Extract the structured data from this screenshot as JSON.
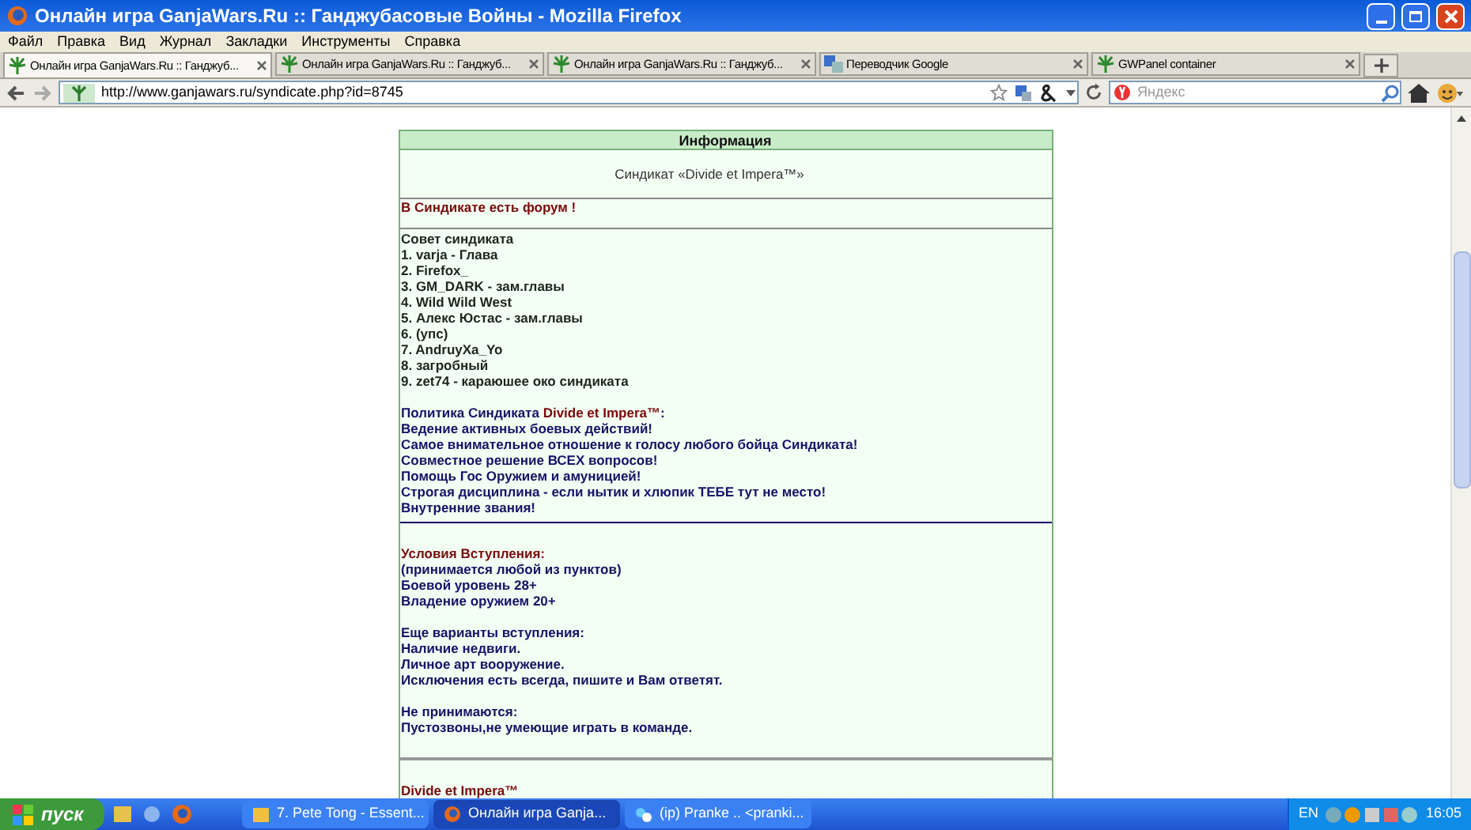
{
  "window": {
    "title": "Онлайн игра GanjaWars.Ru :: Ганджубасовые Войны - Mozilla Firefox"
  },
  "menu": [
    "Файл",
    "Правка",
    "Вид",
    "Журнал",
    "Закладки",
    "Инструменты",
    "Справка"
  ],
  "tabs": [
    {
      "label": "Онлайн игра GanjaWars.Ru :: Ганджуб...",
      "selected": true,
      "kind": "leaf"
    },
    {
      "label": "Онлайн игра GanjaWars.Ru :: Ганджуб...",
      "selected": false,
      "kind": "leaf"
    },
    {
      "label": "Онлайн игра GanjaWars.Ru :: Ганджуб...",
      "selected": false,
      "kind": "leaf"
    },
    {
      "label": "Переводчик Google",
      "selected": false,
      "kind": "translate"
    },
    {
      "label": "GWPanel container",
      "selected": false,
      "kind": "leaf"
    }
  ],
  "address": {
    "url": "http://www.ganjawars.ru/syndicate.php?id=8745"
  },
  "search": {
    "placeholder": "Яндекс"
  },
  "page": {
    "header": "Информация",
    "syndicate_title": "Синдикат «Divide et Impera™»",
    "forum_notice": "В Синдикате есть форум !",
    "content": [
      {
        "kind": "council",
        "text": "Совет синдиката"
      },
      {
        "kind": "council",
        "text": "1. varja - Глава"
      },
      {
        "kind": "council",
        "text": "2. Firefox_"
      },
      {
        "kind": "council",
        "text": "3. GM_DARK - зам.главы"
      },
      {
        "kind": "council",
        "text": "4. Wild Wild West"
      },
      {
        "kind": "council",
        "text": "5. Алекс Юстас - зам.главы"
      },
      {
        "kind": "council",
        "text": "6. (упс)"
      },
      {
        "kind": "council",
        "text": "7. AndruyXa_Yo"
      },
      {
        "kind": "council",
        "text": "8. загробный"
      },
      {
        "kind": "council",
        "text": "9. zet74 - караюшее око синдиката"
      },
      {
        "kind": "gap"
      },
      {
        "kind": "mixed",
        "parts": [
          {
            "kind": "body",
            "text": "Политика Синдиката "
          },
          {
            "kind": "highlight",
            "text": "Divide et Impera™"
          },
          {
            "kind": "body",
            "text": ":"
          }
        ]
      },
      {
        "kind": "body",
        "text": "Ведение активных боевых действий!"
      },
      {
        "kind": "body",
        "text": "Самое внимательное отношение к голосу любого бойца Синдиката!"
      },
      {
        "kind": "body",
        "text": "Совместное решение ВСЕХ вопросов!"
      },
      {
        "kind": "body",
        "text": "Помощь Гос Оружием и амуницией!"
      },
      {
        "kind": "body",
        "text": "Строгая дисциплина - если нытик и хлюпик ТЕБЕ тут не место!"
      },
      {
        "kind": "body",
        "text": "Внутренние звания!"
      },
      {
        "kind": "rule_navy"
      },
      {
        "kind": "gap"
      },
      {
        "kind": "highlight",
        "text": "Условия Вступления:"
      },
      {
        "kind": "body",
        "text": "(принимается любой из пунктов)"
      },
      {
        "kind": "body",
        "text": "Боевой уровень 28+"
      },
      {
        "kind": "body",
        "text": "Владение оружием 20+"
      },
      {
        "kind": "gap"
      },
      {
        "kind": "body",
        "text": "Еще варианты вступления:"
      },
      {
        "kind": "body",
        "text": "Наличие недвиги."
      },
      {
        "kind": "body",
        "text": "Личное арт вооружение."
      },
      {
        "kind": "body",
        "text": "Исключения есть всегда, пишите и Вам ответят."
      },
      {
        "kind": "gap"
      },
      {
        "kind": "body",
        "text": "Не принимаются:"
      },
      {
        "kind": "body",
        "text": "Пустозвоны,не умеющие играть в команде."
      },
      {
        "kind": "gap"
      },
      {
        "kind": "rule_gray"
      },
      {
        "kind": "gap"
      },
      {
        "kind": "highlight",
        "text": "Divide et Impera™"
      }
    ]
  },
  "taskbar": {
    "start": "пуск",
    "tasks": [
      {
        "label": "7. Pete Tong - Essent...",
        "selected": false,
        "kind": "media"
      },
      {
        "label": "Онлайн игра Ganja...",
        "selected": true,
        "kind": "firefox"
      },
      {
        "label": "(ip) Pranke .. <pranki...",
        "selected": false,
        "kind": "chat"
      }
    ],
    "language": "EN",
    "clock": "16:05"
  }
}
